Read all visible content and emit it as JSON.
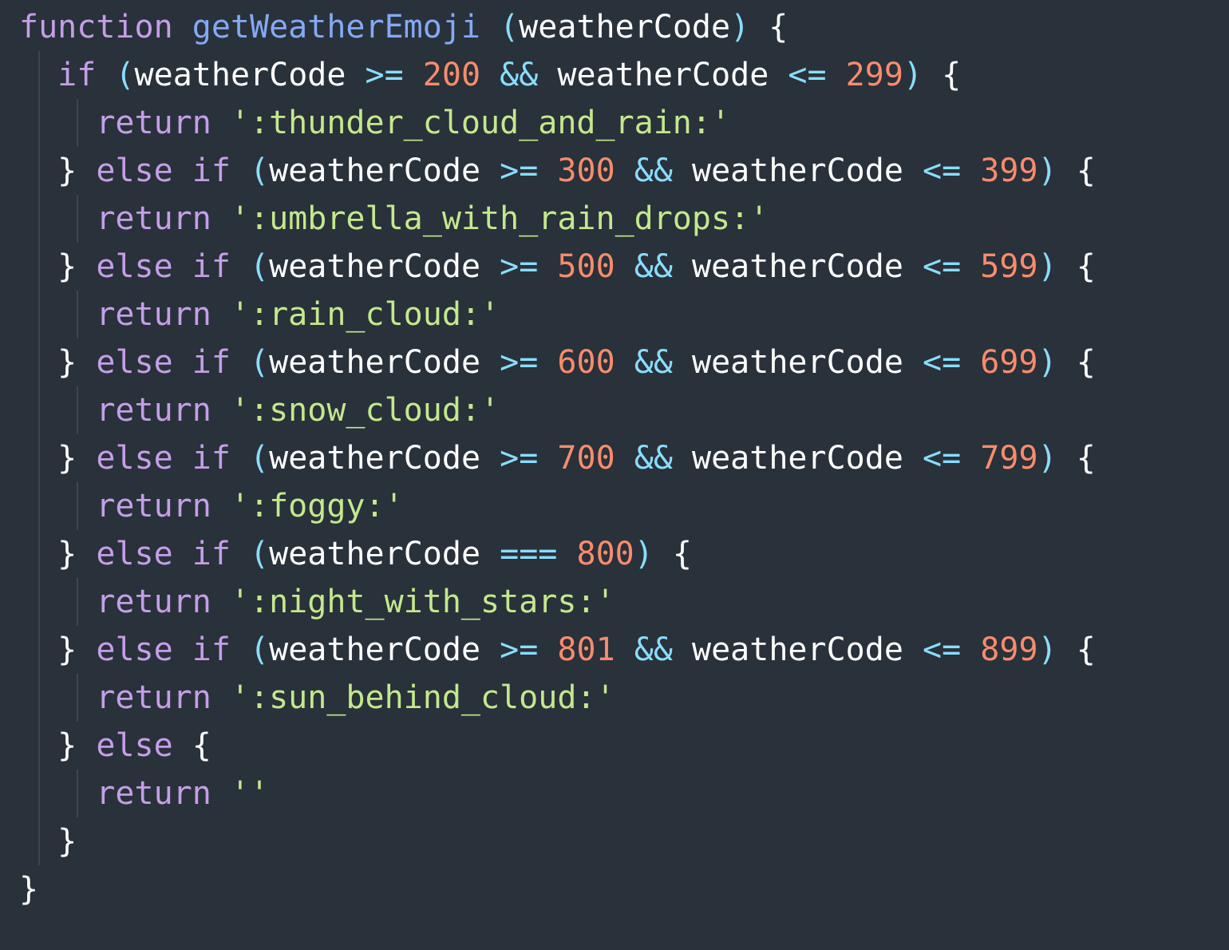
{
  "code": {
    "lines": [
      "function getWeatherEmoji (weatherCode) {",
      "  if (weatherCode >= 200 && weatherCode <= 299) {",
      "    return ':thunder_cloud_and_rain:'",
      "  } else if (weatherCode >= 300 && weatherCode <= 399) {",
      "    return ':umbrella_with_rain_drops:'",
      "  } else if (weatherCode >= 500 && weatherCode <= 599) {",
      "    return ':rain_cloud:'",
      "  } else if (weatherCode >= 600 && weatherCode <= 699) {",
      "    return ':snow_cloud:'",
      "  } else if (weatherCode >= 700 && weatherCode <= 799) {",
      "    return ':foggy:'",
      "  } else if (weatherCode === 800) {",
      "    return ':night_with_stars:'",
      "  } else if (weatherCode >= 801 && weatherCode <= 899) {",
      "    return ':sun_behind_cloud:'",
      "  } else {",
      "    return ''",
      "  }",
      "}"
    ]
  },
  "colors": {
    "background": "#29313a",
    "keyword": "#c59ee8",
    "function_name": "#84a9f4",
    "operator": "#89ddff",
    "number": "#f78c6c",
    "string": "#c3e88d",
    "identifier": "#ffffff"
  }
}
